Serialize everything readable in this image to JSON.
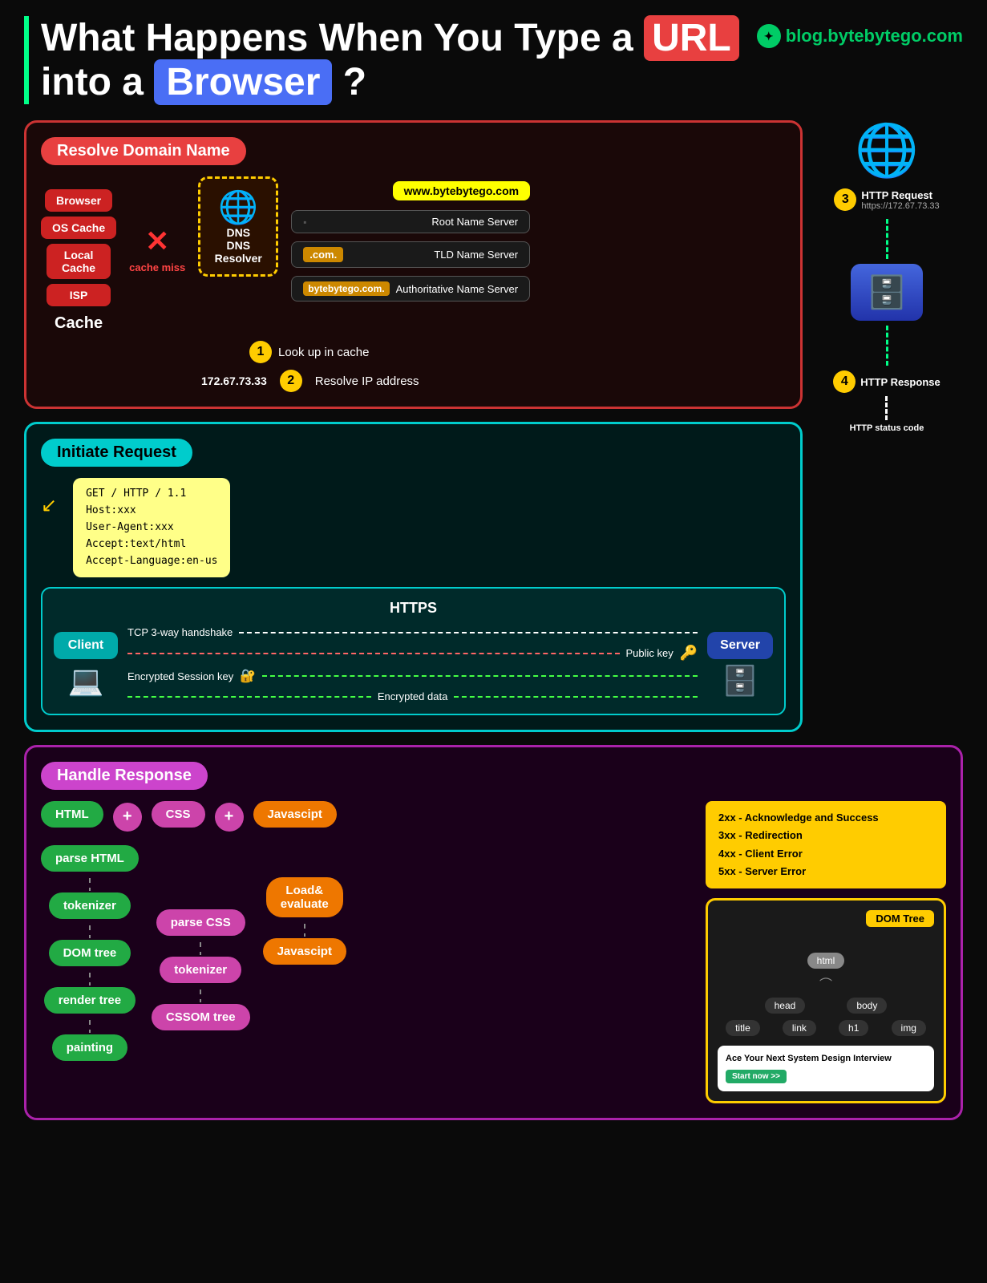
{
  "page": {
    "title": "What Happens When You Type a URL into a Browser?",
    "title_url": "URL",
    "title_browser": "Browser",
    "brand": "blog.bytebytego.com"
  },
  "resolve_domain": {
    "section_title": "Resolve Domain Name",
    "step1_label": "Look up in cache",
    "url_example": "www.bytebytego.com",
    "cache_items": [
      "Browser",
      "OS Cache",
      "Local Cache",
      "ISP"
    ],
    "cache_main_label": "Cache",
    "cache_miss": "cache miss",
    "dns_label": "DNS Resolver",
    "name_servers": [
      {
        "name": "Root Name Server",
        "badge": ""
      },
      {
        "name": "TLD Name Server",
        "badge": ".com."
      },
      {
        "name": "Authoritative Name Server",
        "badge": "bytebytego.com."
      }
    ],
    "ip_address": "172.67.73.33",
    "step2_label": "Resolve IP address",
    "step3_label": "HTTP Request",
    "step3_sub": "https://172.67.73.33",
    "step4_label": "HTTP Response",
    "http_status_label": "HTTP status code"
  },
  "initiate_request": {
    "section_title": "Initiate Request",
    "http_lines": [
      "GET / HTTP / 1.1",
      "Host:xxx",
      "User-Agent:xxx",
      "Accept:text/html",
      "Accept-Language:en-us"
    ],
    "https_title": "HTTPS",
    "tcp_label": "TCP 3-way handshake",
    "public_key_label": "Public key",
    "session_key_label": "Encrypted Session key",
    "encrypted_data_label": "Encrypted data",
    "client_label": "Client",
    "server_label": "Server"
  },
  "handle_response": {
    "section_title": "Handle Response",
    "top_items": [
      "HTML",
      "CSS",
      "Javascipt"
    ],
    "plus_label": "+",
    "pipeline1": {
      "items": [
        "parse HTML",
        "tokenizer",
        "DOM tree",
        "render tree",
        "painting"
      ]
    },
    "pipeline2": {
      "items": [
        "parse CSS",
        "tokenizer",
        "CSSOM tree"
      ]
    },
    "pipeline3": {
      "items": [
        "Load& evaluate",
        "Javascipt"
      ]
    },
    "status_codes": [
      "2xx - Acknowledge and Success",
      "3xx - Redirection",
      "4xx - Client Error",
      "5xx - Server Error"
    ],
    "dom_tree_title": "DOM Tree",
    "dom_nodes": {
      "root": "html",
      "level1": [
        "head",
        "body"
      ],
      "level2_head": [
        "title",
        "link"
      ],
      "level2_body": [
        "h1",
        "img"
      ]
    },
    "ad_title": "Ace Your Next System Design Interview",
    "ad_cta": "Start now >>"
  }
}
